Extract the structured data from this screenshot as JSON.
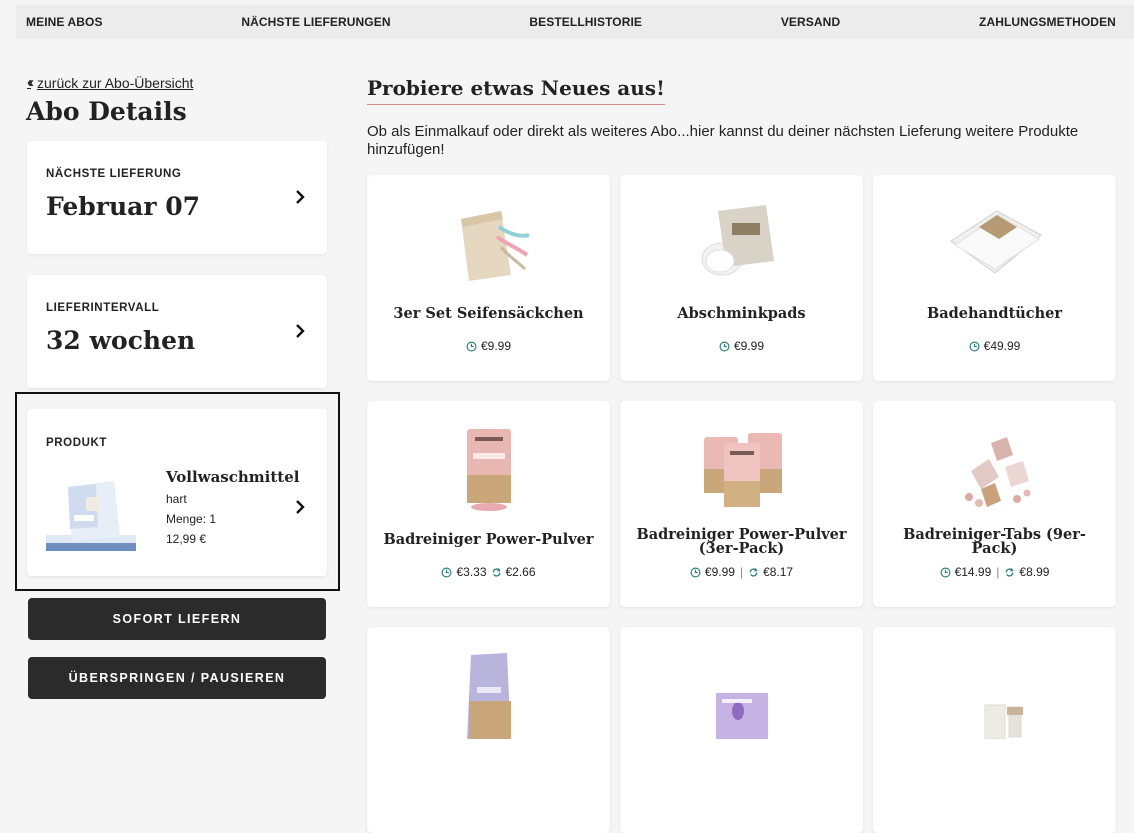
{
  "nav": {
    "items": [
      "MEINE ABOS",
      "NÄCHSTE LIEFERUNGEN",
      "BESTELLHISTORIE",
      "VERSAND",
      "ZAHLUNGSMETHODEN"
    ]
  },
  "sidebar": {
    "back_link": "zurück zur Abo-Übersicht",
    "title": "Abo Details",
    "next_delivery": {
      "label": "NÄCHSTE LIEFERUNG",
      "value": "Februar 07"
    },
    "interval": {
      "label": "LIEFERINTERVALL",
      "value": "32 wochen"
    },
    "product": {
      "label": "PRODUKT",
      "name": "Vollwaschmittel",
      "variant": "hart",
      "quantity": "Menge: 1",
      "price": "12,99 €"
    },
    "buttons": {
      "deliver_now": "SOFORT LIEFERN",
      "skip_pause": "ÜBERSPRINGEN / PAUSIEREN"
    }
  },
  "main": {
    "title": "Probiere etwas Neues aus!",
    "intro": "Ob als Einmalkauf oder direkt als weiteres Abo...hier kannst du deiner nächsten Lieferung weitere Produkte hinzufügen!",
    "products": [
      {
        "name": "3er Set Seifensäckchen",
        "price_once": "€9.99",
        "price_sub": "",
        "image_color": "#e6d7c0"
      },
      {
        "name": "Abschminkpads",
        "price_once": "€9.99",
        "price_sub": "",
        "image_color": "#d9d2c7"
      },
      {
        "name": "Badehandtücher",
        "price_once": "€49.99",
        "price_sub": "",
        "image_color": "#eeeeee"
      },
      {
        "name": "Badreiniger Power-Pulver",
        "price_once": "€3.33",
        "price_sub": "€2.66",
        "image_color": "#e9b7b2"
      },
      {
        "name": "Badreiniger Power-Pulver (3er-Pack)",
        "price_once": "€9.99",
        "price_sub": "€8.17",
        "image_color": "#ebb9b5"
      },
      {
        "name": "Badreiniger-Tabs (9er-Pack)",
        "price_once": "€14.99",
        "price_sub": "€8.99",
        "image_color": "#e3c9c3"
      },
      {
        "name": "",
        "price_once": "",
        "price_sub": "",
        "image_color": "#b8b4dc"
      },
      {
        "name": "",
        "price_once": "",
        "price_sub": "",
        "image_color": "#c7b3e3"
      },
      {
        "name": "",
        "price_once": "",
        "price_sub": "",
        "image_color": "#eeeae4"
      }
    ]
  },
  "colors": {
    "dark_button": "#2b2b2b",
    "underline_accent": "#d38a8a",
    "page_bg": "#f5f5f5"
  },
  "icons": {
    "once": "one-time-purchase-icon",
    "subscription": "subscription-cycle-icon",
    "arrow": "chevron-right-icon",
    "back": "double-chevron-left-icon"
  }
}
